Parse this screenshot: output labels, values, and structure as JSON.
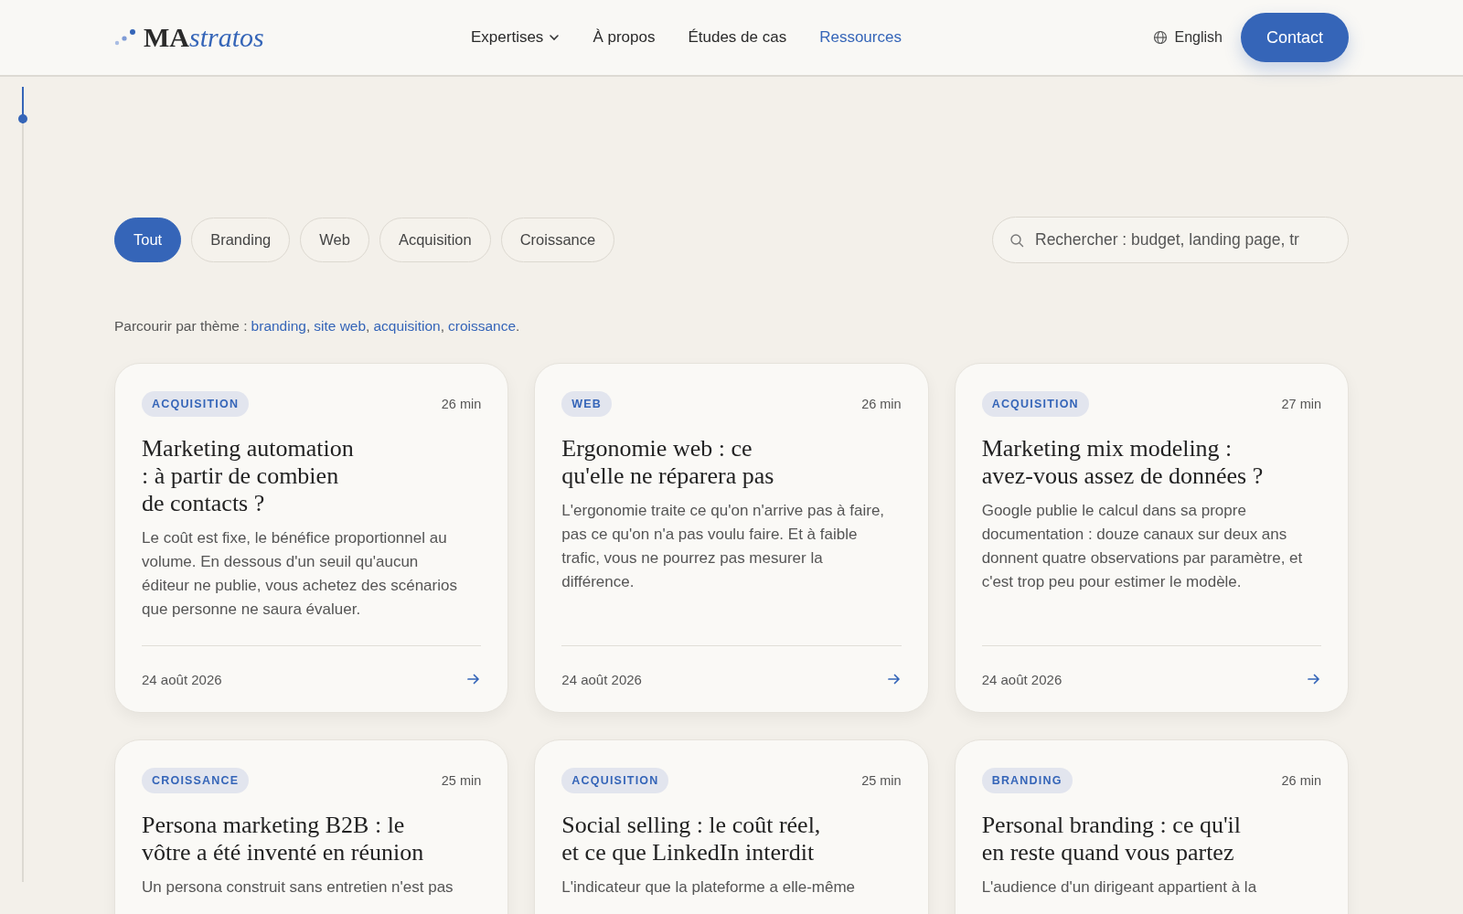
{
  "logo": {
    "bold": "MA",
    "italic": "stratos"
  },
  "nav": [
    {
      "label": "Expertises",
      "dropdown": true,
      "selected": false
    },
    {
      "label": "À propos",
      "dropdown": false,
      "selected": false
    },
    {
      "label": "Études de cas",
      "dropdown": false,
      "selected": false
    },
    {
      "label": "Ressources",
      "dropdown": false,
      "selected": true
    }
  ],
  "language": "English",
  "contact": "Contact",
  "reading_progress": {
    "level": 0.04
  },
  "filters": [
    {
      "label": "Tout",
      "selected": true
    },
    {
      "label": "Branding",
      "selected": false
    },
    {
      "label": "Web",
      "selected": false
    },
    {
      "label": "Acquisition",
      "selected": false
    },
    {
      "label": "Croissance",
      "selected": false
    }
  ],
  "search": {
    "placeholder": "Rechercher : budget, landing page, tr"
  },
  "themes": {
    "prefix": "Parcourir par thème :",
    "links": [
      {
        "label": "branding",
        "after": ","
      },
      {
        "label": "site web",
        "after": ","
      },
      {
        "label": "acquisition",
        "after": ","
      },
      {
        "label": "croissance",
        "after": "."
      }
    ]
  },
  "cards": [
    {
      "category": "ACQUISITION",
      "read_time": "26 min",
      "title": "Marketing automation\n: à partir de combien\nde contacts ?",
      "excerpt": "Le coût est fixe, le bénéfice proportionnel au volume. En dessous d'un seuil qu'aucun éditeur ne publie, vous achetez des scénarios que personne ne saura évaluer.",
      "date": "24 août 2026"
    },
    {
      "category": "WEB",
      "read_time": "26 min",
      "title": "Ergonomie web : ce\nqu'elle ne réparera pas",
      "excerpt": "L'ergonomie traite ce qu'on n'arrive pas à faire, pas ce qu'on n'a pas voulu faire. Et à faible trafic, vous ne pourrez pas mesurer la différence.",
      "date": "24 août 2026"
    },
    {
      "category": "ACQUISITION",
      "read_time": "27 min",
      "title": "Marketing mix modeling :\navez-vous assez de données ?",
      "excerpt": "Google publie le calcul dans sa propre documentation : douze canaux sur deux ans donnent quatre observations par paramètre, et c'est trop peu pour estimer le modèle.",
      "date": "24 août 2026"
    },
    {
      "category": "CROISSANCE",
      "read_time": "25 min",
      "title": "Persona marketing B2B : le\nvôtre a été inventé en réunion",
      "excerpt": "Un persona construit sans entretien n'est pas"
    },
    {
      "category": "ACQUISITION",
      "read_time": "25 min",
      "title": "Social selling : le coût réel,\net ce que LinkedIn interdit",
      "excerpt": "L'indicateur que la plateforme a elle-même"
    },
    {
      "category": "BRANDING",
      "read_time": "26 min",
      "title": "Personal branding : ce qu'il\nen reste quand vous partez",
      "excerpt": "L'audience d'un dirigeant appartient à la"
    }
  ]
}
